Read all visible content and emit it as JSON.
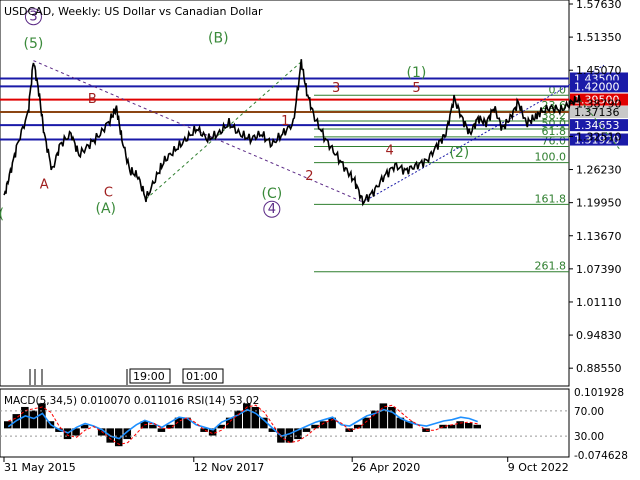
{
  "window": {
    "title": "USDCAD, Weekly:  US Dollar vs Canadian Dollar"
  },
  "colors": {
    "background": "#ffffff",
    "price": "#000000",
    "level_blue": "#1a1aa8",
    "level_red": "#e00000",
    "level_brown": "#8b4513",
    "fib_green": "#2f7f2f",
    "wave_green": "#3a8a3a",
    "wave_red": "#a02020",
    "wave_purple": "#5b2a86",
    "macd_hist": "#000000",
    "rsi_line": "#1e90ff",
    "macd_signal": "#ff0000",
    "label_blue_bg": "#1a1aa8",
    "label_red_bg": "#e00000",
    "label_gray_bg": "#c8c8c8"
  },
  "chart_data": {
    "type": "line",
    "title": "USDCAD, Weekly:  US Dollar vs Canadian Dollar",
    "xlabel": "",
    "ylabel": "",
    "ylim": [
      0.8555,
      1.5763
    ],
    "y_ticks": [
      "1.57630",
      "1.51350",
      "1.45070",
      "1.38790",
      "1.32510",
      "1.26230",
      "1.19950",
      "1.13670",
      "1.07390",
      "1.01110",
      "0.94830",
      "0.88550"
    ],
    "x_ticks": [
      "31 May 2015",
      "12 Nov 2017",
      "26 Apr 2020",
      "9 Oct 2022"
    ],
    "x_tick_t": [
      0,
      0.3295,
      0.6045,
      0.8745
    ],
    "price_path": [
      {
        "t": 0.0,
        "v": 1.21
      },
      {
        "t": 0.01,
        "v": 1.25
      },
      {
        "t": 0.025,
        "v": 1.31
      },
      {
        "t": 0.045,
        "v": 1.37
      },
      {
        "t": 0.055,
        "v": 1.4689
      },
      {
        "t": 0.065,
        "v": 1.41
      },
      {
        "t": 0.075,
        "v": 1.33
      },
      {
        "t": 0.09,
        "v": 1.26
      },
      {
        "t": 0.105,
        "v": 1.31
      },
      {
        "t": 0.125,
        "v": 1.33
      },
      {
        "t": 0.14,
        "v": 1.29
      },
      {
        "t": 0.16,
        "v": 1.31
      },
      {
        "t": 0.18,
        "v": 1.33
      },
      {
        "t": 0.2,
        "v": 1.36
      },
      {
        "t": 0.21,
        "v": 1.3793
      },
      {
        "t": 0.22,
        "v": 1.32
      },
      {
        "t": 0.235,
        "v": 1.26
      },
      {
        "t": 0.25,
        "v": 1.25
      },
      {
        "t": 0.265,
        "v": 1.2062
      },
      {
        "t": 0.285,
        "v": 1.25
      },
      {
        "t": 0.3,
        "v": 1.28
      },
      {
        "t": 0.32,
        "v": 1.3
      },
      {
        "t": 0.34,
        "v": 1.32
      },
      {
        "t": 0.36,
        "v": 1.34
      },
      {
        "t": 0.38,
        "v": 1.32
      },
      {
        "t": 0.4,
        "v": 1.33
      },
      {
        "t": 0.42,
        "v": 1.35
      },
      {
        "t": 0.44,
        "v": 1.33
      },
      {
        "t": 0.46,
        "v": 1.32
      },
      {
        "t": 0.48,
        "v": 1.33
      },
      {
        "t": 0.5,
        "v": 1.31
      },
      {
        "t": 0.52,
        "v": 1.33
      },
      {
        "t": 0.54,
        "v": 1.35
      },
      {
        "t": 0.555,
        "v": 1.4667
      },
      {
        "t": 0.565,
        "v": 1.41
      },
      {
        "t": 0.58,
        "v": 1.36
      },
      {
        "t": 0.6,
        "v": 1.32
      },
      {
        "t": 0.62,
        "v": 1.29
      },
      {
        "t": 0.64,
        "v": 1.26
      },
      {
        "t": 0.655,
        "v": 1.24
      },
      {
        "t": 0.67,
        "v": 1.2007
      },
      {
        "t": 0.69,
        "v": 1.22
      },
      {
        "t": 0.71,
        "v": 1.25
      },
      {
        "t": 0.73,
        "v": 1.27
      },
      {
        "t": 0.75,
        "v": 1.26
      },
      {
        "t": 0.77,
        "v": 1.27
      },
      {
        "t": 0.79,
        "v": 1.28
      },
      {
        "t": 0.81,
        "v": 1.31
      },
      {
        "t": 0.825,
        "v": 1.33
      },
      {
        "t": 0.84,
        "v": 1.3977
      },
      {
        "t": 0.855,
        "v": 1.36
      },
      {
        "t": 0.87,
        "v": 1.33
      },
      {
        "t": 0.885,
        "v": 1.36
      },
      {
        "t": 0.9,
        "v": 1.35
      },
      {
        "t": 0.915,
        "v": 1.38
      },
      {
        "t": 0.93,
        "v": 1.34
      },
      {
        "t": 0.945,
        "v": 1.36
      },
      {
        "t": 0.96,
        "v": 1.39
      },
      {
        "t": 0.975,
        "v": 1.35
      },
      {
        "t": 0.99,
        "v": 1.36
      },
      {
        "t": 1.0,
        "v": 1.37
      },
      {
        "t": 1.02,
        "v": 1.38
      },
      {
        "t": 1.04,
        "v": 1.375
      },
      {
        "t": 1.06,
        "v": 1.39
      },
      {
        "t": 1.075,
        "v": 1.3958
      }
    ],
    "levels": [
      {
        "label": "1.43500",
        "value": 1.435,
        "color": "#1a1aa8",
        "bg": "#1a1aa8"
      },
      {
        "label": "1.42000",
        "value": 1.42,
        "color": "#1a1aa8",
        "bg": "#1a1aa8"
      },
      {
        "label": "1.39500",
        "value": 1.395,
        "color": "#e00000",
        "bg": "#e00000"
      },
      {
        "label": "1.37136",
        "value": 1.37136,
        "color": "#8b4513",
        "bg": "#c8c8c8"
      },
      {
        "label": "1.34653",
        "value": 1.34653,
        "color": "#1a1aa8",
        "bg": "#1a1aa8"
      },
      {
        "label": "1.31920",
        "value": 1.3192,
        "color": "#1a1aa8",
        "bg": "#1a1aa8"
      }
    ],
    "fib_levels": [
      {
        "label": "0.0",
        "value": 1.4032
      },
      {
        "label": "23.6",
        "value": 1.373
      },
      {
        "label": "38.2",
        "value": 1.3543
      },
      {
        "label": "50.0",
        "value": 1.3393
      },
      {
        "label": "61.8",
        "value": 1.3242
      },
      {
        "label": "76.0",
        "value": 1.3061
      },
      {
        "label": "100.0",
        "value": 1.2753
      },
      {
        "label": "161.8",
        "value": 1.1963
      },
      {
        "label": "261.8",
        "value": 1.0685
      }
    ],
    "wave_labels": [
      {
        "text": "3",
        "t": 0.055,
        "v": 1.5446,
        "style": "purple",
        "circled": true
      },
      {
        "text": "(5)",
        "t": 0.055,
        "v": 1.493,
        "style": "green"
      },
      {
        "text": "A",
        "t": 0.075,
        "v": 1.2266,
        "style": "red"
      },
      {
        "text": "B",
        "t": 0.165,
        "v": 1.3889,
        "style": "red"
      },
      {
        "text": "C",
        "t": 0.195,
        "v": 1.2108,
        "style": "red"
      },
      {
        "text": "(A)",
        "t": 0.19,
        "v": 1.1802,
        "style": "green"
      },
      {
        "text": "(B)",
        "t": 0.4,
        "v": 1.5036,
        "style": "green"
      },
      {
        "text": "(C)",
        "t": 0.5,
        "v": 1.2086,
        "style": "green"
      },
      {
        "text": "4",
        "t": 0.5,
        "v": 1.1795,
        "style": "purple",
        "circled": true
      },
      {
        "text": "1",
        "t": 0.525,
        "v": 1.3466,
        "style": "red"
      },
      {
        "text": "2",
        "t": 0.57,
        "v": 1.2425,
        "style": "red"
      },
      {
        "text": "3",
        "t": 0.62,
        "v": 1.4095,
        "style": "red"
      },
      {
        "text": "4",
        "t": 0.72,
        "v": 1.2912,
        "style": "red"
      },
      {
        "text": "(1)",
        "t": 0.77,
        "v": 1.4382,
        "style": "green"
      },
      {
        "text": "5",
        "t": 0.77,
        "v": 1.4095,
        "style": "red"
      },
      {
        "text": "(2)",
        "t": 0.85,
        "v": 1.2858,
        "style": "green"
      },
      {
        "text": "(",
        "t": -0.005,
        "v": 1.1694,
        "style": "green"
      }
    ],
    "indicator": {
      "label": "MACD(5,34,5) 0.010070 0.011016 RSI(14) 53.02",
      "ticks": [
        "0.101928",
        "70.00",
        "30.00",
        "-0.074628"
      ],
      "rsi": [
        45,
        55,
        62,
        58,
        66,
        48,
        40,
        35,
        44,
        50,
        46,
        40,
        30,
        26,
        38,
        48,
        55,
        50,
        44,
        52,
        60,
        58,
        48,
        44,
        40,
        52,
        58,
        64,
        72,
        66,
        55,
        42,
        30,
        34,
        40,
        46,
        52,
        56,
        60,
        48,
        46,
        54,
        62,
        66,
        72,
        68,
        58,
        52,
        48,
        46,
        50,
        54,
        56,
        60,
        58,
        53
      ],
      "macd": [
        0.02,
        0.04,
        0.06,
        0.05,
        0.07,
        0.02,
        -0.01,
        -0.03,
        -0.02,
        0.01,
        0.0,
        -0.02,
        -0.04,
        -0.05,
        -0.03,
        0.0,
        0.02,
        0.01,
        -0.01,
        0.01,
        0.03,
        0.03,
        0.0,
        -0.01,
        -0.02,
        0.01,
        0.03,
        0.05,
        0.07,
        0.06,
        0.03,
        -0.01,
        -0.04,
        -0.04,
        -0.03,
        -0.01,
        0.01,
        0.02,
        0.03,
        0.0,
        -0.01,
        0.01,
        0.03,
        0.05,
        0.07,
        0.06,
        0.03,
        0.02,
        0.0,
        -0.01,
        0.0,
        0.01,
        0.01,
        0.02,
        0.015,
        0.01
      ]
    },
    "timeframe_labels": [
      "19:00",
      "01:00"
    ]
  }
}
